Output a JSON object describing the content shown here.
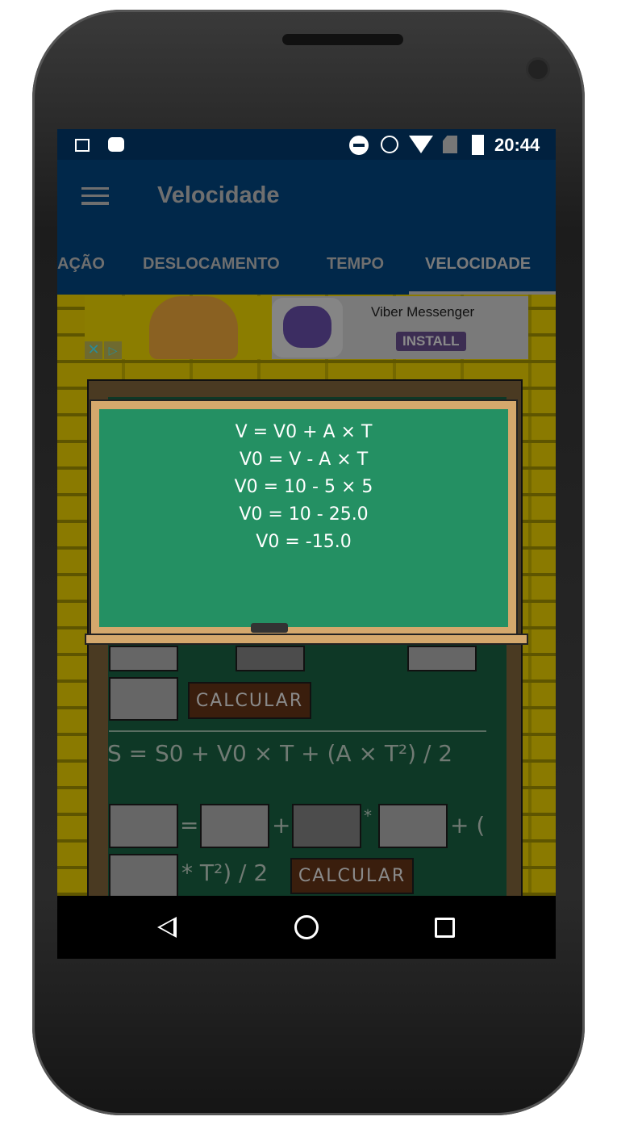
{
  "status_bar": {
    "time": "20:44",
    "icons": [
      "image-icon",
      "android-icon",
      "dnd-icon",
      "alarm-icon",
      "wifi-icon",
      "no-sim-icon",
      "battery-charging-icon"
    ]
  },
  "app_bar": {
    "title": "Velocidade",
    "menu_icon": "hamburger-icon"
  },
  "tabs": [
    {
      "label": "AÇÃO"
    },
    {
      "label": "DESLOCAMENTO"
    },
    {
      "label": "TEMPO"
    },
    {
      "label": "VELOCIDADE",
      "selected": true
    }
  ],
  "ad": {
    "title": "Viber Messenger",
    "cta": "INSTALL",
    "close_icon": "close-icon",
    "adchoices_icon": "adchoices-icon"
  },
  "result_board": {
    "lines": [
      "V = V0 + A × T",
      "V0 = V - A × T",
      "V0 = 10 - 5 × 5",
      "V0 = 10 - 25.0",
      "V0 = -15.0"
    ]
  },
  "form": {
    "calcular_1": "CALCULAR",
    "formula": "S = S0 + V0 × T + (A × T²) / 2",
    "op_equals": "=",
    "op_plus": "+",
    "op_times": "*",
    "op_plus_paren": "+ (",
    "tail": "* T²) / 2",
    "calcular_2": "CALCULAR"
  },
  "nav": {
    "back": "back-icon",
    "home": "home-icon",
    "recents": "recents-icon"
  }
}
